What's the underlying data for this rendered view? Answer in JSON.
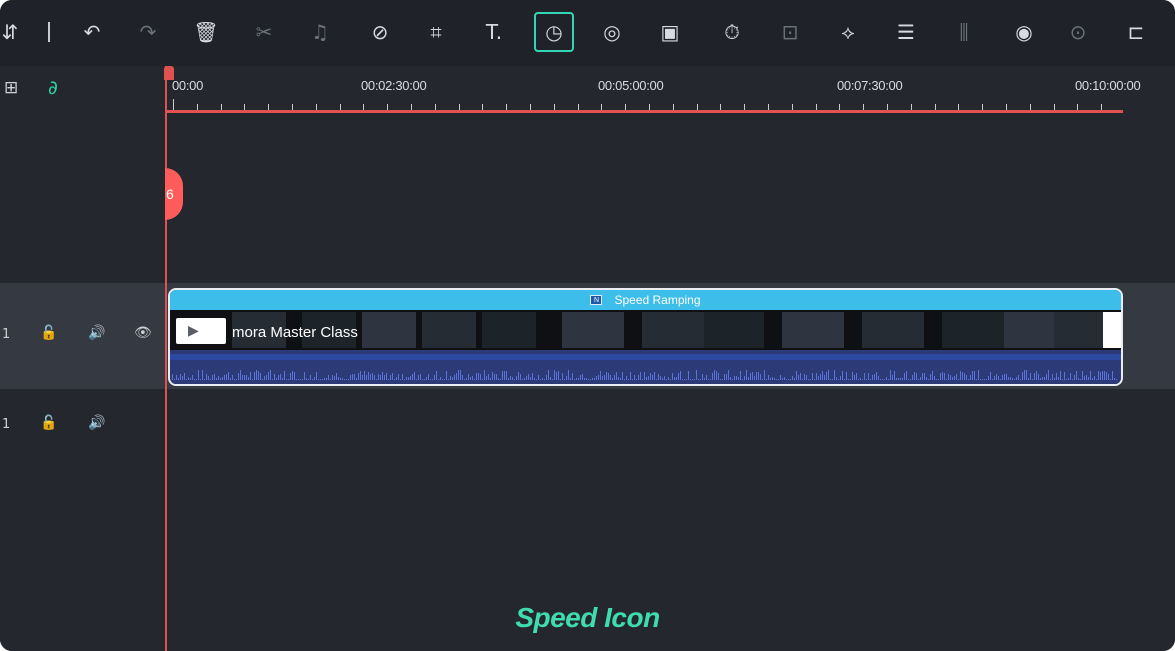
{
  "toolbar": {
    "buttons": [
      {
        "name": "layers-icon",
        "glyph": "⇵"
      },
      {
        "name": "undo-icon",
        "glyph": "↶"
      },
      {
        "name": "redo-icon",
        "glyph": "↷"
      },
      {
        "name": "delete-icon",
        "glyph": "🗑"
      },
      {
        "name": "cut-icon",
        "glyph": "✂"
      },
      {
        "name": "audio-detach-icon",
        "glyph": "♫"
      },
      {
        "name": "tag-icon",
        "glyph": "⊘"
      },
      {
        "name": "crop-icon",
        "glyph": "⌗"
      },
      {
        "name": "text-icon",
        "glyph": "T."
      },
      {
        "name": "speed-icon",
        "glyph": "◷"
      },
      {
        "name": "color-icon",
        "glyph": "◎"
      },
      {
        "name": "freeze-frame-icon",
        "glyph": "▣"
      },
      {
        "name": "timer-icon",
        "glyph": "⏱"
      },
      {
        "name": "zoom-fit-icon",
        "glyph": "⊡"
      },
      {
        "name": "keyframe-icon",
        "glyph": "⟡"
      },
      {
        "name": "adjust-icon",
        "glyph": "☰"
      },
      {
        "name": "audio-wave-icon",
        "glyph": "⫼"
      },
      {
        "name": "voice-icon",
        "glyph": "◉"
      },
      {
        "name": "tts-icon",
        "glyph": "⊙"
      },
      {
        "name": "more-icon",
        "glyph": "⊏"
      }
    ]
  },
  "ruler": {
    "labels": [
      "00:00",
      "00:02:30:00",
      "00:05:00:00",
      "00:07:30:00",
      "00:10:00:00"
    ]
  },
  "header": {
    "add_track_icon": "⊞",
    "link_icon": "∂"
  },
  "playhead": {
    "marker_text": "6"
  },
  "video_track": {
    "number": "1",
    "lock_icon": "🔓",
    "audio_icon": "🔊",
    "eye_icon": "👁"
  },
  "audio_track": {
    "number": "1",
    "lock_icon": "🔓",
    "audio_icon": "🔊"
  },
  "clip": {
    "effect_label": "Speed Ramping",
    "effect_badge": "N",
    "title": "mora Master Class",
    "play_glyph": "▶"
  },
  "caption": "Speed Icon",
  "colors": {
    "accent": "#33d6b4",
    "playhead": "#e0524f",
    "clip_bar": "#3dbde9",
    "caption": "#3fdcb0"
  }
}
